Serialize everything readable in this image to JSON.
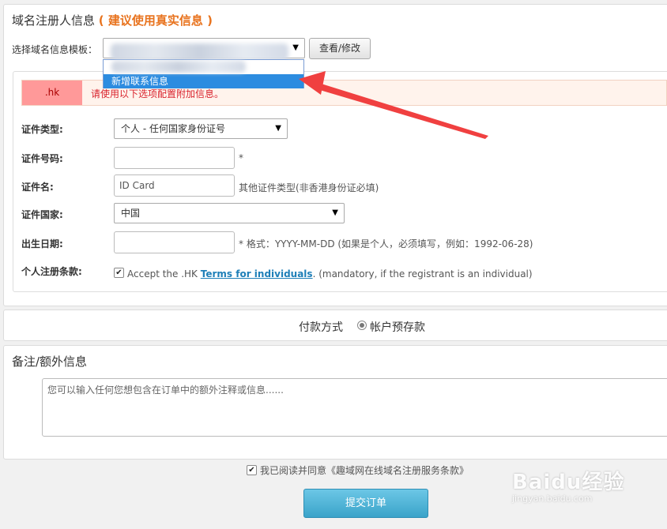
{
  "registrant": {
    "title": "域名注册人信息",
    "title_hint": "( 建议使用真实信息 )",
    "template_label": "选择域名信息模板：",
    "template_selected": "",
    "view_edit_button": "查看/修改",
    "dropdown_options": [
      "",
      "新增联系信息"
    ]
  },
  "hk_section": {
    "tag": ".hk",
    "message": "请使用以下选项配置附加信息。",
    "id_type_label": "证件类型:",
    "id_type_value": "个人 - 任何国家身份证号",
    "id_number_label": "证件号码:",
    "id_number_value": "",
    "id_number_required": "*",
    "id_name_label": "证件名:",
    "id_name_value": "ID Card",
    "id_name_note": "其他证件类型(非香港身份证必填)",
    "country_label": "证件国家:",
    "country_value": "中国",
    "birthdate_label": "出生日期:",
    "birthdate_value": "",
    "birthdate_note": "* 格式：YYYY-MM-DD (如果是个人，必须填写，例如：1992-06-28)",
    "terms_label": "个人注册条款:",
    "terms_prefix": "Accept the .HK ",
    "terms_link": "Terms for individuals",
    "terms_suffix": ". (mandatory, if the registrant is an individual)",
    "terms_checked": true
  },
  "payment": {
    "label": "付款方式",
    "option": "帐户预存款"
  },
  "remarks": {
    "title": "备注/额外信息",
    "placeholder": "您可以输入任何您想包含在订单中的额外注释或信息......"
  },
  "agreement": {
    "text": "我已阅读并同意《趣域网在线域名注册服务条款》",
    "checked": true
  },
  "submit_button": "提交订单",
  "watermark": {
    "brand": "Baidu经验",
    "url": "jingyan.baidu.com"
  },
  "colors": {
    "accent_orange": "#e8731e",
    "alert_red": "#d9232d",
    "submit_blue": "#3aa3c9",
    "annotation_arrow": "#f04040"
  }
}
